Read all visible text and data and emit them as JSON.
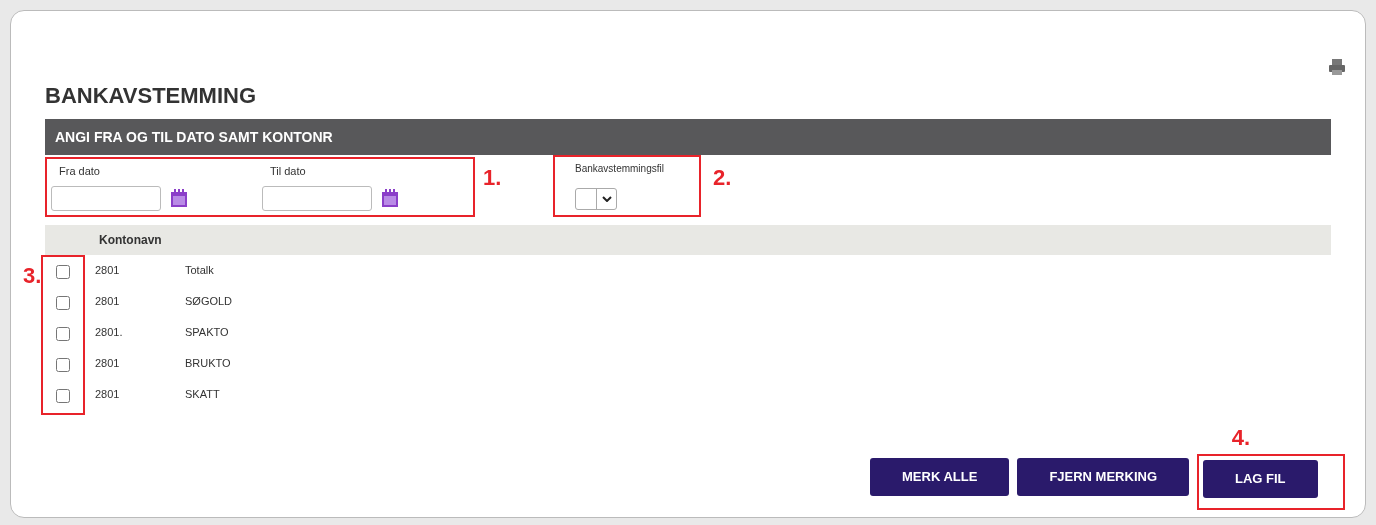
{
  "title": "BANKAVSTEMMING",
  "section_bar": "ANGI FRA OG TIL DATO SAMT KONTONR",
  "date_group": {
    "marker": "1.",
    "fields": [
      {
        "label": "Fra dato"
      },
      {
        "label": "Til dato"
      }
    ]
  },
  "file_group": {
    "marker": "2.",
    "label": "Bankavstemmingsfil"
  },
  "table": {
    "marker": "3.",
    "columns": [
      "Kontonavn"
    ],
    "rows": [
      {
        "number": "2801",
        "name": "Totalk",
        "checked": false
      },
      {
        "number": "2801",
        "name": "SØGOLD",
        "checked": false
      },
      {
        "number": "2801.",
        "name": "SPAKTO",
        "checked": false
      },
      {
        "number": "2801",
        "name": "BRUKTO",
        "checked": false
      },
      {
        "number": "2801",
        "name": "SKATT",
        "checked": false
      }
    ]
  },
  "buttons": [
    {
      "label": "MERK ALLE"
    },
    {
      "label": "FJERN MERKING"
    },
    {
      "label": "LAG FIL",
      "marker": "4."
    }
  ]
}
